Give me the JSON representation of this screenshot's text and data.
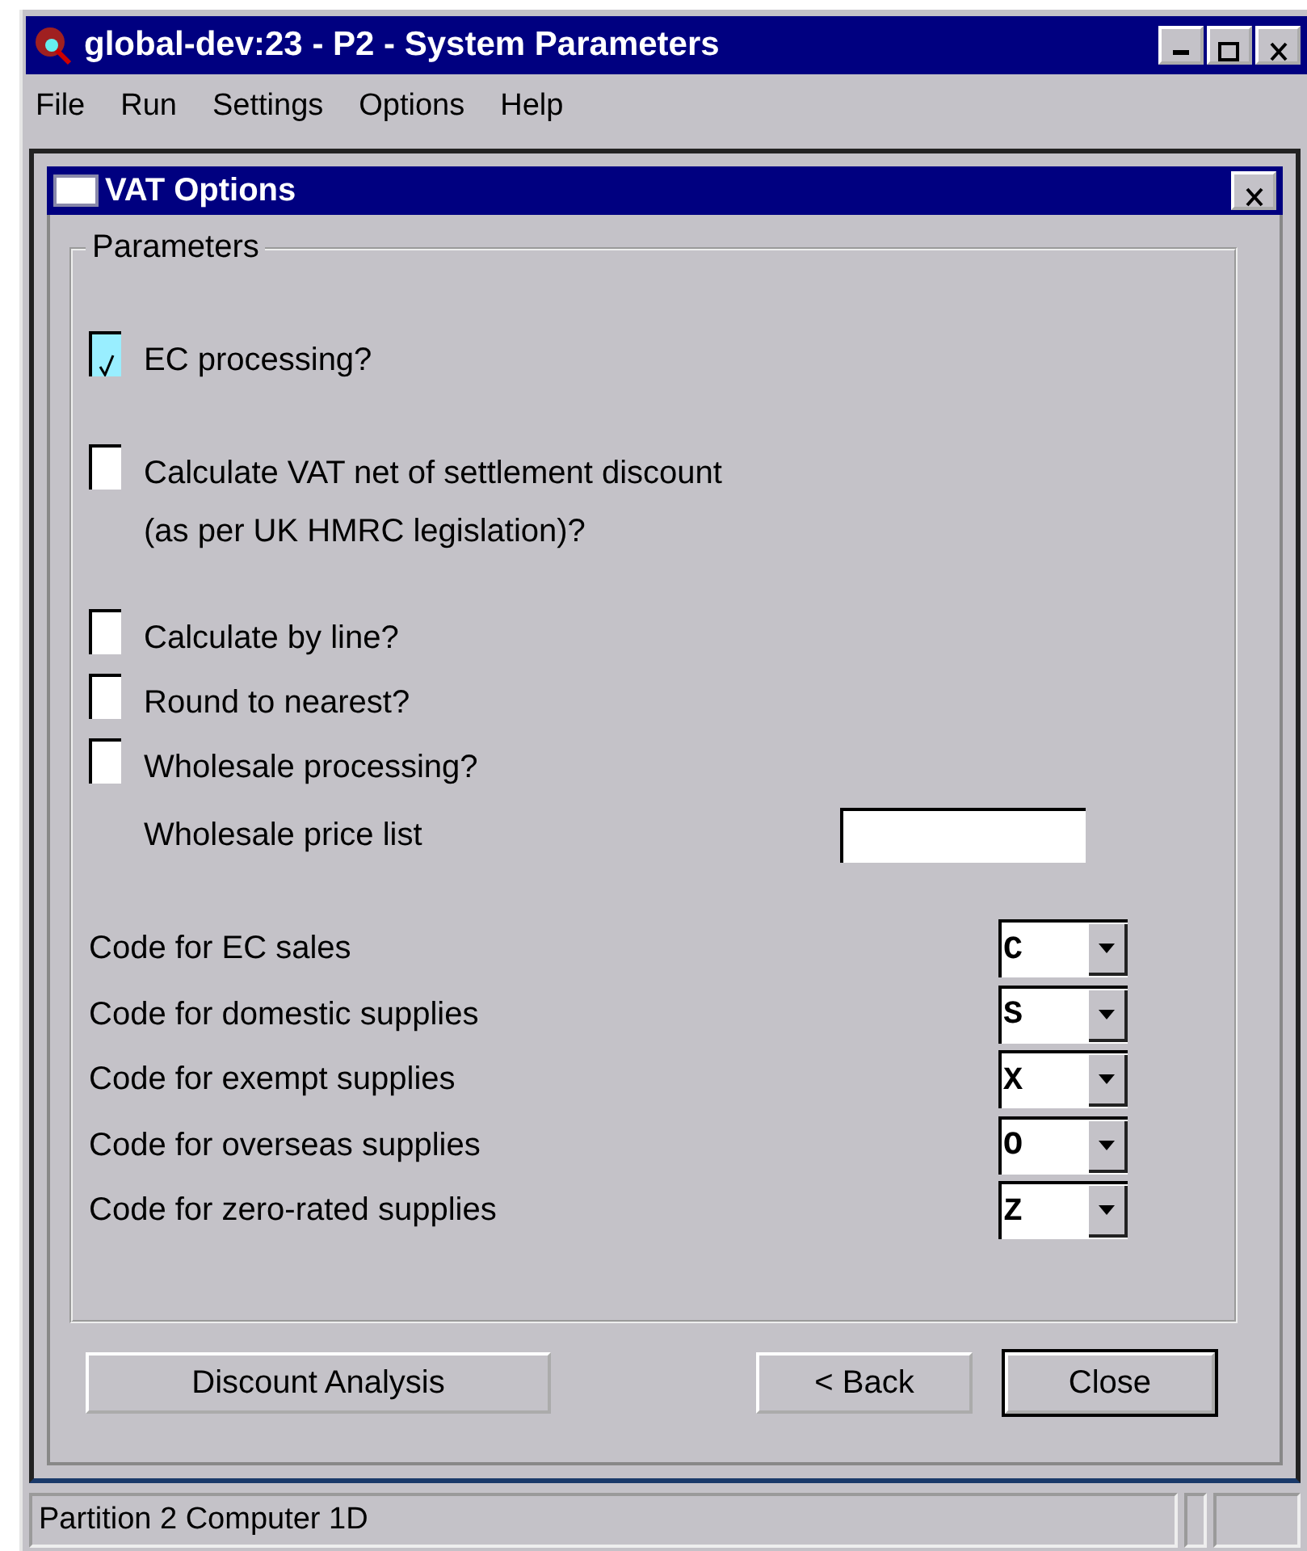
{
  "window": {
    "title": "global-dev:23 - P2 - System Parameters"
  },
  "menu": [
    "File",
    "Run",
    "Settings",
    "Options",
    "Help"
  ],
  "dialog": {
    "title": "VAT Options",
    "group": "Parameters",
    "options": [
      {
        "kind": "checkbox",
        "label": "EC processing?",
        "checked": true,
        "focused": true
      },
      {
        "kind": "checkbox",
        "label": "Calculate VAT net of settlement discount",
        "note": "(as per UK HMRC legislation)?",
        "checked": false,
        "focused": false
      },
      {
        "kind": "checkbox",
        "label": "Calculate by line?",
        "checked": false,
        "focused": false
      },
      {
        "kind": "checkbox",
        "label": "Round to nearest?",
        "checked": false,
        "focused": false
      },
      {
        "kind": "checkbox",
        "label": "Wholesale processing?",
        "checked": false,
        "focused": false
      },
      {
        "kind": "field",
        "label": "Wholesale price list"
      }
    ],
    "codes": [
      {
        "label": "Code for EC sales",
        "value": "C"
      },
      {
        "label": "Code for domestic supplies",
        "value": "S"
      },
      {
        "label": "Code for exempt supplies",
        "value": "X"
      },
      {
        "label": "Code for overseas supplies",
        "value": "O"
      },
      {
        "label": "Code for zero-rated supplies",
        "value": "Z"
      }
    ],
    "buttons": [
      {
        "label": "Discount Analysis",
        "default": false
      },
      {
        "label": "< Back",
        "default": false
      },
      {
        "label": "Close",
        "default": true
      }
    ]
  },
  "status_bar": "Partition 2 Computer 1D"
}
